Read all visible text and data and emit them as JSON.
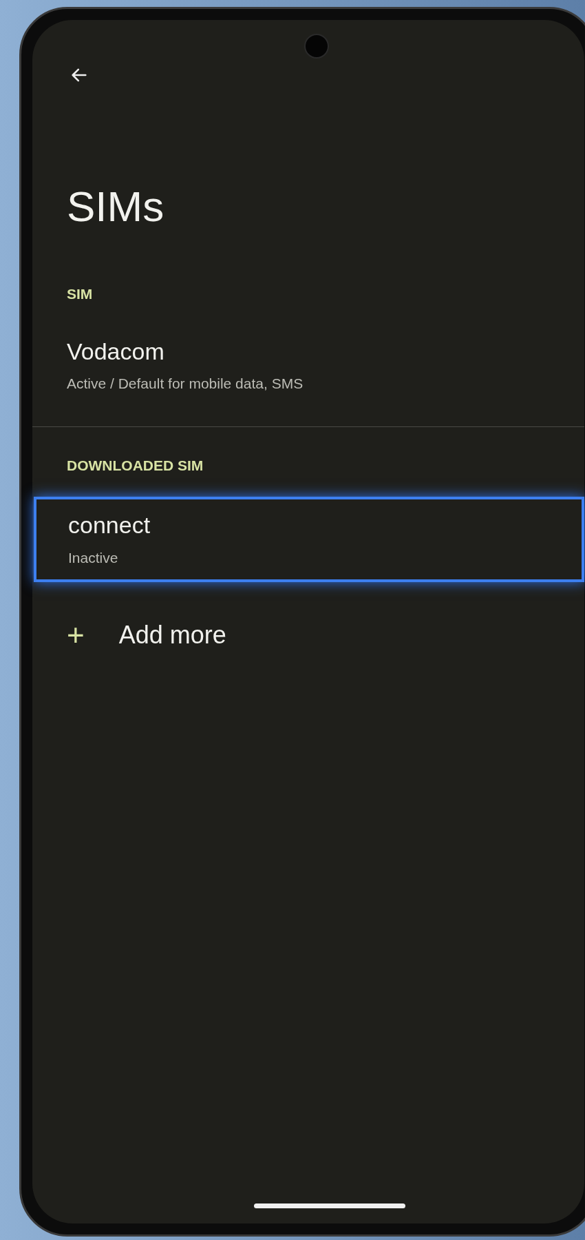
{
  "title": "SIMs",
  "sections": [
    {
      "header": "SIM",
      "items": [
        {
          "name": "Vodacom",
          "status": "Active / Default for mobile data, SMS",
          "selected": false
        }
      ]
    },
    {
      "header": "DOWNLOADED SIM",
      "items": [
        {
          "name": "connect",
          "status": "Inactive",
          "selected": true
        }
      ]
    }
  ],
  "add_button": {
    "icon": "+",
    "label": "Add more"
  }
}
